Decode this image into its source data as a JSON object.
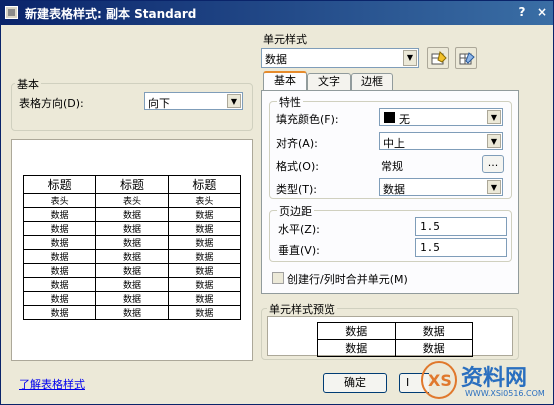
{
  "window": {
    "title": "新建表格样式: 副本 Standard",
    "help": "?",
    "close": "×"
  },
  "basic_group": {
    "label": "基本",
    "direction_label": "表格方向(D):",
    "direction_value": "向下"
  },
  "preview_table": {
    "header_cells": [
      "标题",
      "标题",
      "标题"
    ],
    "subheader_cells": [
      "表头",
      "表头",
      "表头"
    ],
    "data_rows": [
      [
        "数据",
        "数据",
        "数据"
      ],
      [
        "数据",
        "数据",
        "数据"
      ],
      [
        "数据",
        "数据",
        "数据"
      ],
      [
        "数据",
        "数据",
        "数据"
      ],
      [
        "数据",
        "数据",
        "数据"
      ],
      [
        "数据",
        "数据",
        "数据"
      ],
      [
        "数据",
        "数据",
        "数据"
      ],
      [
        "数据",
        "数据",
        "数据"
      ]
    ]
  },
  "cell_style": {
    "label": "单元样式",
    "value": "数据"
  },
  "tabs": [
    {
      "label": "基本"
    },
    {
      "label": "文字"
    },
    {
      "label": "边框"
    }
  ],
  "properties": {
    "label": "特性",
    "fill_label": "填充颜色(F):",
    "fill_value": "无",
    "align_label": "对齐(A):",
    "align_value": "中上",
    "format_label": "格式(O):",
    "format_value": "常规",
    "format_button": "...",
    "type_label": "类型(T):",
    "type_value": "数据"
  },
  "margins": {
    "label": "页边距",
    "horizontal_label": "水平(Z):",
    "horizontal_value": "1.5",
    "vertical_label": "垂直(V):",
    "vertical_value": "1.5"
  },
  "merge_checkbox": {
    "label": "创建行/列时合并单元(M)"
  },
  "cell_preview": {
    "label": "单元样式预览",
    "cells": [
      [
        "数据",
        "数据"
      ],
      [
        "数据",
        "数据"
      ]
    ]
  },
  "footer": {
    "link": "了解表格样式",
    "ok": "确定",
    "cancel_partial": "I"
  },
  "watermark": {
    "text": "资料网",
    "url": "WWW.XSi0516.COM"
  }
}
